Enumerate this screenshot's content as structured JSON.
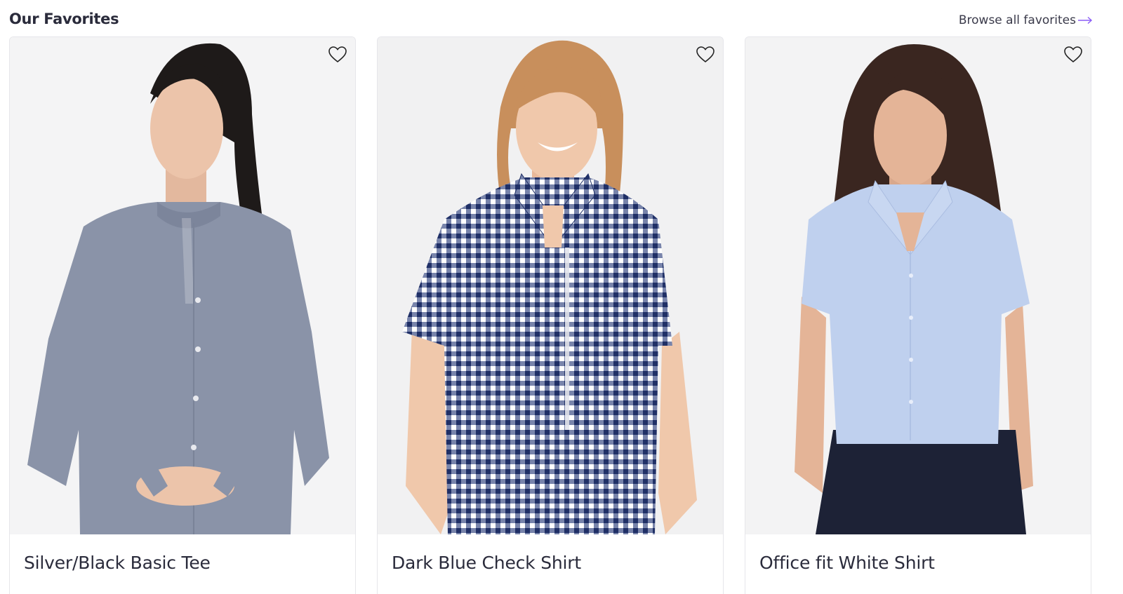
{
  "section": {
    "title": "Our Favorites",
    "browse_label": "Browse all favorites",
    "arrow_icon": "arrow-right-icon",
    "accent_color": "#8b5cf6"
  },
  "products": [
    {
      "name": "Silver/Black Basic Tee",
      "image_desc": "woman-in-grey-long-sleeve-blouse",
      "favorite_icon": "heart-outline-icon",
      "shirt_color": "#8a93a8"
    },
    {
      "name": "Dark Blue Check Shirt",
      "image_desc": "woman-in-navy-gingham-shirt",
      "favorite_icon": "heart-outline-icon",
      "shirt_color": "#1f2f66"
    },
    {
      "name": "Office fit White Shirt",
      "image_desc": "woman-in-light-blue-office-shirt",
      "favorite_icon": "heart-outline-icon",
      "shirt_color": "#bfd0ee"
    }
  ]
}
